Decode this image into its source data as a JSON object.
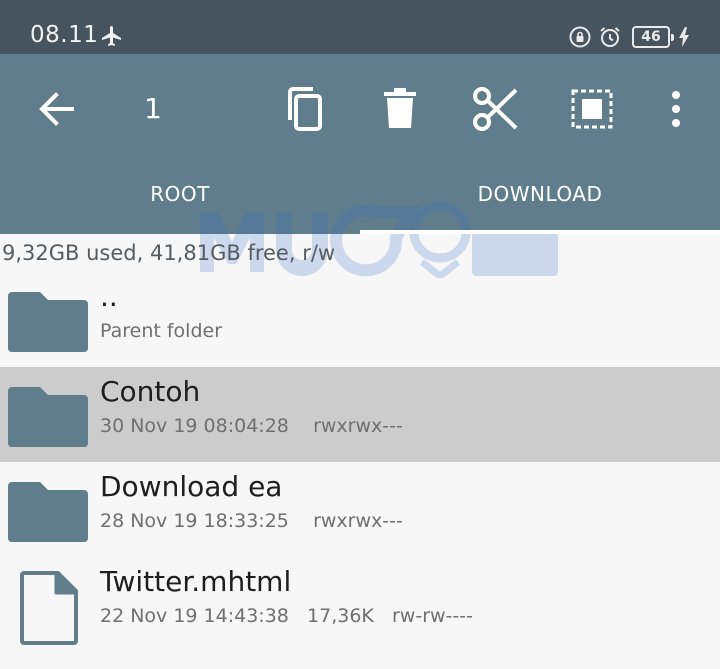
{
  "status_bar": {
    "time": "08.11",
    "battery_level": "46"
  },
  "toolbar": {
    "selected_count": "1"
  },
  "tabs": [
    {
      "label": "ROOT"
    },
    {
      "label": "DOWNLOAD"
    }
  ],
  "storage_info": "9,32GB used, 41,81GB free, r/w",
  "files": [
    {
      "name": "..",
      "subtitle": "Parent folder",
      "icon": "folder-icon"
    },
    {
      "name": "Contoh",
      "date": "30 Nov 19 08:04:28",
      "size": "",
      "perms": "rwxrwx---",
      "icon": "folder-icon",
      "selected": true
    },
    {
      "name": "Download ea",
      "date": "28 Nov 19 18:33:25",
      "size": "",
      "perms": "rwxrwx---",
      "icon": "folder-icon"
    },
    {
      "name": "Twitter.mhtml",
      "date": "22 Nov 19 14:43:38",
      "size": "17,36K",
      "perms": "rw-rw----",
      "icon": "file-icon"
    }
  ],
  "colors": {
    "status_bar_bg": "#45545e",
    "toolbar_bg": "#607d8b",
    "icon_fill": "#607d8b",
    "selected_row_bg": "#cccccc"
  }
}
